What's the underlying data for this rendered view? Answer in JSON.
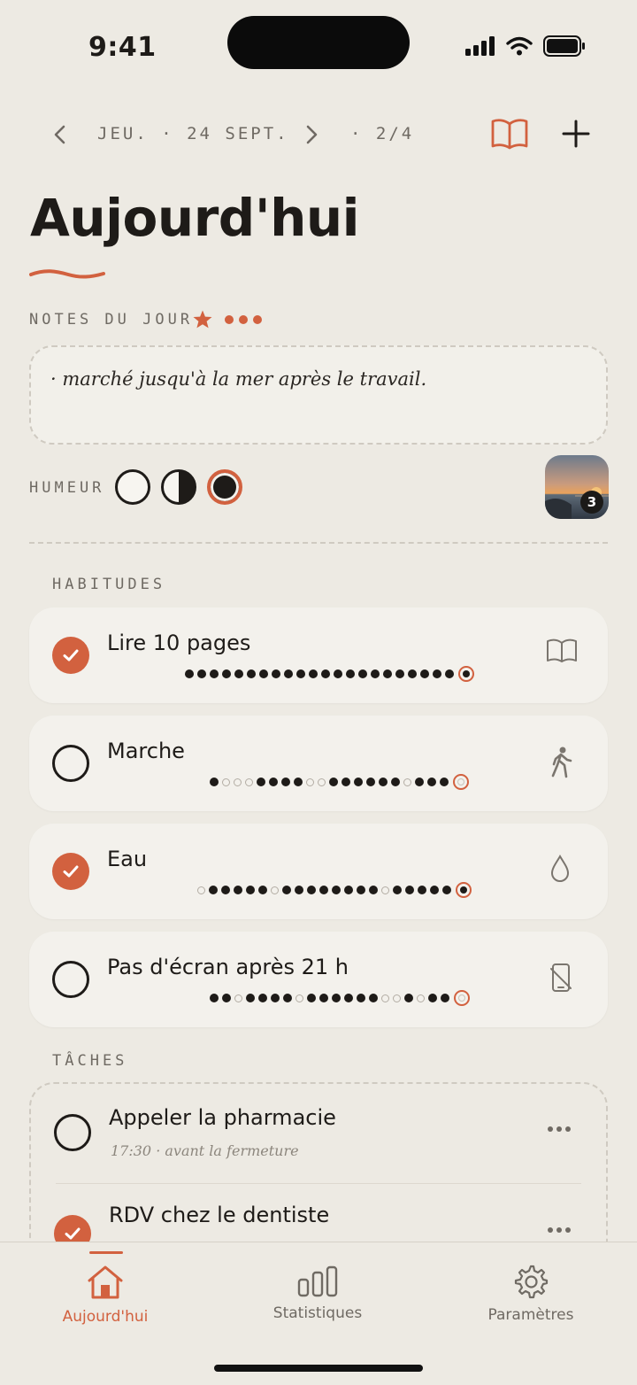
{
  "status": {
    "time": "9:41"
  },
  "header": {
    "date": "JEU. · 24 SEPT.",
    "count": "· 2/4",
    "icons": [
      "chevron-left-icon",
      "chevron-right-icon",
      "book-icon",
      "plus-icon"
    ]
  },
  "page": {
    "title": "Aujourd'hui"
  },
  "notes": {
    "label": "NOTES DU JOUR",
    "text": "· marché jusqu'à la mer après le travail."
  },
  "mood": {
    "label": "HUMEUR",
    "options": [
      "vide",
      "moitié",
      "plein"
    ],
    "selected": "plein"
  },
  "photo": {
    "count": "3"
  },
  "habits": {
    "label": "HABITUDES",
    "items": [
      {
        "name": "Lire 10 pages",
        "done": true,
        "icon": "book-icon",
        "history": [
          1,
          1,
          1,
          1,
          1,
          1,
          1,
          1,
          1,
          1,
          1,
          1,
          1,
          1,
          1,
          1,
          1,
          1,
          1,
          1,
          1,
          1
        ]
      },
      {
        "name": "Marche",
        "done": false,
        "icon": "walk-icon",
        "history": [
          1,
          0,
          0,
          0,
          1,
          1,
          1,
          1,
          0,
          0,
          1,
          1,
          1,
          1,
          1,
          1,
          0,
          1,
          1,
          1
        ]
      },
      {
        "name": "Eau",
        "done": true,
        "icon": "water-drop-icon",
        "history": [
          0,
          1,
          1,
          1,
          1,
          1,
          0,
          1,
          1,
          1,
          1,
          1,
          1,
          1,
          1,
          0,
          1,
          1,
          1,
          1,
          1
        ]
      },
      {
        "name": "Pas d'écran après 21 h",
        "done": false,
        "icon": "no-phone-icon",
        "history": [
          1,
          1,
          0,
          1,
          1,
          1,
          1,
          0,
          1,
          1,
          1,
          1,
          1,
          1,
          0,
          0,
          1,
          0,
          1,
          1
        ]
      }
    ]
  },
  "tasks": {
    "label": "TÂCHES",
    "items": [
      {
        "name": "Appeler la pharmacie",
        "sub": "17:30 · avant la fermeture",
        "done": false
      },
      {
        "name": "RDV chez le dentiste",
        "sub": "",
        "done": true
      }
    ]
  },
  "tabs": [
    {
      "label": "Aujourd'hui",
      "active": true,
      "icon": "home-icon"
    },
    {
      "label": "Statistiques",
      "active": false,
      "icon": "bar-chart-icon"
    },
    {
      "label": "Paramètres",
      "active": false,
      "icon": "gear-icon"
    }
  ],
  "colors": {
    "accent": "#D2613F",
    "background": "#EDEAE3",
    "card": "#F3F1EC",
    "ink": "#1E1B18"
  }
}
